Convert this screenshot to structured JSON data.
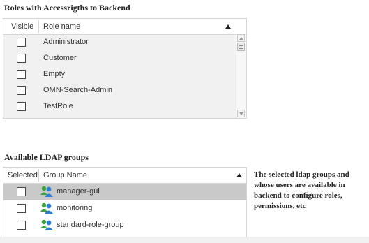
{
  "roles": {
    "title": "Roles with Accessrigths to Backend",
    "columns": {
      "visible": "Visible",
      "role_name": "Role name"
    },
    "rows": [
      {
        "name": "Administrator",
        "checked": false
      },
      {
        "name": "Customer",
        "checked": false
      },
      {
        "name": "Empty",
        "checked": false
      },
      {
        "name": "OMN-Search-Admin",
        "checked": false
      },
      {
        "name": "TestRole",
        "checked": false
      }
    ]
  },
  "ldap": {
    "title": "Available LDAP groups",
    "columns": {
      "selected": "Selected",
      "group_name": "Group Name"
    },
    "rows": [
      {
        "name": "manager-gui",
        "selected_row": true,
        "checked": false
      },
      {
        "name": "monitoring",
        "selected_row": false,
        "checked": false
      },
      {
        "name": "standard-role-group",
        "selected_row": false,
        "checked": false
      }
    ],
    "help_text": "The selected ldap groups and whose users are available in backend to configure roles, permissions, etc"
  },
  "colors": {
    "selected_row": "#c9c9c9",
    "panel_bg": "#f1f1f1",
    "icon_blue": "#2e7fd0",
    "icon_green": "#3aa43a"
  },
  "icons": {
    "sort": "sort-ascending-icon",
    "group": "user-group-icon"
  }
}
